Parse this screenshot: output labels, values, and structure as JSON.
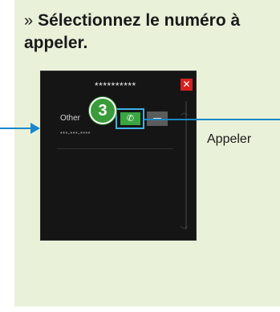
{
  "instruction": {
    "chevron": "»",
    "text": "Sélectionnez le numéro à appeler."
  },
  "screen": {
    "contact_name": "**********",
    "close_symbol": "✕",
    "entry_label": "Other",
    "entry_number": "***-***-****",
    "call_symbol": "✆",
    "scroll_up": "︿",
    "scroll_down": "﹀"
  },
  "step_number": "3",
  "callout_label": "Appeler",
  "colors": {
    "panel": "#e9f1d9",
    "accent_blue": "#1a88c9",
    "call_green": "#3aa641",
    "close_red": "#d52020"
  }
}
